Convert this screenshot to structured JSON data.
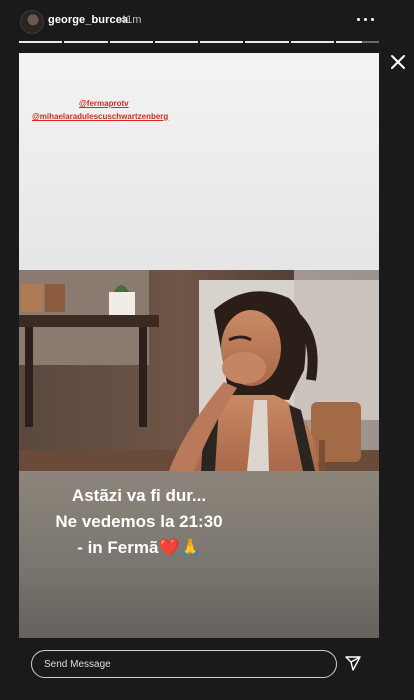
{
  "header": {
    "username": "george_burcea",
    "time": "41m",
    "progress": {
      "segments": 8,
      "current_index": 7,
      "current_fraction": 0.6
    }
  },
  "story": {
    "mentions": [
      "@fermaprotv",
      "@mihaelaradulescuschwartzenberg"
    ],
    "caption": [
      "Astãzi va fi dur...",
      "Ne vedemos la 21:30",
      "- in Fermã❤️🙏"
    ]
  },
  "footer": {
    "message_placeholder": "Send Message"
  },
  "icons": {
    "more": "more-horizontal-icon",
    "close": "close-icon",
    "send": "send-icon"
  }
}
